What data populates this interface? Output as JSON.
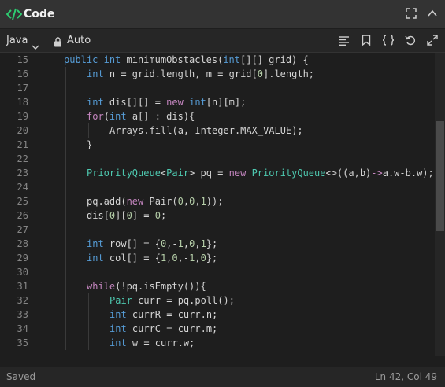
{
  "panel": {
    "title": "Code"
  },
  "toolbar": {
    "language": "Java",
    "mode": "Auto"
  },
  "editor": {
    "lines": [
      {
        "n": "15",
        "indent": 1,
        "segs": [
          [
            "kw",
            "public"
          ],
          [
            "t",
            " "
          ],
          [
            "kw",
            "int"
          ],
          [
            "t",
            " minimumObstacles("
          ],
          [
            "kw",
            "int"
          ],
          [
            "t",
            "[][] grid) {"
          ]
        ]
      },
      {
        "n": "16",
        "indent": 2,
        "segs": [
          [
            "kw",
            "int"
          ],
          [
            "t",
            " n = grid.length, m = grid["
          ],
          [
            "num",
            "0"
          ],
          [
            "t",
            "].length;"
          ]
        ]
      },
      {
        "n": "17",
        "indent": 0,
        "segs": []
      },
      {
        "n": "18",
        "indent": 2,
        "segs": [
          [
            "kw",
            "int"
          ],
          [
            "t",
            " dis[][] = "
          ],
          [
            "kw2",
            "new"
          ],
          [
            "t",
            " "
          ],
          [
            "kw",
            "int"
          ],
          [
            "t",
            "[n][m];"
          ]
        ]
      },
      {
        "n": "19",
        "indent": 2,
        "segs": [
          [
            "kw2",
            "for"
          ],
          [
            "t",
            "("
          ],
          [
            "kw",
            "int"
          ],
          [
            "t",
            " a[] : dis){"
          ]
        ]
      },
      {
        "n": "20",
        "indent": 3,
        "segs": [
          [
            "t",
            "Arrays.fill(a, Integer.MAX_VALUE);"
          ]
        ]
      },
      {
        "n": "21",
        "indent": 2,
        "segs": [
          [
            "t",
            "}"
          ]
        ]
      },
      {
        "n": "22",
        "indent": 0,
        "segs": []
      },
      {
        "n": "23",
        "indent": 2,
        "segs": [
          [
            "ty",
            "PriorityQueue"
          ],
          [
            "t",
            "<"
          ],
          [
            "ty",
            "Pair"
          ],
          [
            "t",
            "> pq = "
          ],
          [
            "kw2",
            "new"
          ],
          [
            "t",
            " "
          ],
          [
            "ty",
            "PriorityQueue"
          ],
          [
            "t",
            "<>((a,b)"
          ],
          [
            "op",
            "->"
          ],
          [
            "t",
            "a.w-b.w);"
          ]
        ]
      },
      {
        "n": "24",
        "indent": 0,
        "segs": []
      },
      {
        "n": "25",
        "indent": 2,
        "segs": [
          [
            "t",
            "pq.add("
          ],
          [
            "kw2",
            "new"
          ],
          [
            "t",
            " Pair("
          ],
          [
            "num",
            "0"
          ],
          [
            "t",
            ","
          ],
          [
            "num",
            "0"
          ],
          [
            "t",
            ","
          ],
          [
            "num",
            "1"
          ],
          [
            "t",
            "));"
          ]
        ]
      },
      {
        "n": "26",
        "indent": 2,
        "segs": [
          [
            "t",
            "dis["
          ],
          [
            "num",
            "0"
          ],
          [
            "t",
            "]["
          ],
          [
            "num",
            "0"
          ],
          [
            "t",
            "] = "
          ],
          [
            "num",
            "0"
          ],
          [
            "t",
            ";"
          ]
        ]
      },
      {
        "n": "27",
        "indent": 0,
        "segs": []
      },
      {
        "n": "28",
        "indent": 2,
        "segs": [
          [
            "kw",
            "int"
          ],
          [
            "t",
            " row[] = {"
          ],
          [
            "num",
            "0"
          ],
          [
            "t",
            ",-"
          ],
          [
            "num",
            "1"
          ],
          [
            "t",
            ","
          ],
          [
            "num",
            "0"
          ],
          [
            "t",
            ","
          ],
          [
            "num",
            "1"
          ],
          [
            "t",
            "};"
          ]
        ]
      },
      {
        "n": "29",
        "indent": 2,
        "segs": [
          [
            "kw",
            "int"
          ],
          [
            "t",
            " col[] = {"
          ],
          [
            "num",
            "1"
          ],
          [
            "t",
            ","
          ],
          [
            "num",
            "0"
          ],
          [
            "t",
            ",-"
          ],
          [
            "num",
            "1"
          ],
          [
            "t",
            ","
          ],
          [
            "num",
            "0"
          ],
          [
            "t",
            "};"
          ]
        ]
      },
      {
        "n": "30",
        "indent": 0,
        "segs": []
      },
      {
        "n": "31",
        "indent": 2,
        "segs": [
          [
            "kw2",
            "while"
          ],
          [
            "t",
            "(!pq.isEmpty()){"
          ]
        ]
      },
      {
        "n": "32",
        "indent": 3,
        "segs": [
          [
            "ty",
            "Pair"
          ],
          [
            "t",
            " curr = pq.poll();"
          ]
        ]
      },
      {
        "n": "33",
        "indent": 3,
        "segs": [
          [
            "kw",
            "int"
          ],
          [
            "t",
            " currR = curr.n;"
          ]
        ]
      },
      {
        "n": "34",
        "indent": 3,
        "segs": [
          [
            "kw",
            "int"
          ],
          [
            "t",
            " currC = curr.m;"
          ]
        ]
      },
      {
        "n": "35",
        "indent": 3,
        "segs": [
          [
            "kw",
            "int"
          ],
          [
            "t",
            " w = curr.w;"
          ]
        ]
      }
    ]
  },
  "status": {
    "left": "Saved",
    "right": "Ln 42, Col 49"
  },
  "colors": {
    "kw": "#569cd6",
    "kw2": "#c586c0",
    "num": "#b5cea8",
    "ty": "#4ec9b0",
    "op": "#c586c0",
    "t": "#d4d4d4",
    "accent": "#2ecc71"
  },
  "icons": [
    "code-brackets-icon",
    "fullscreen-icon",
    "chevron-up-icon",
    "chevron-down-icon",
    "lock-icon",
    "format-icon",
    "bookmark-icon",
    "braces-icon",
    "undo-icon",
    "expand-icon"
  ]
}
